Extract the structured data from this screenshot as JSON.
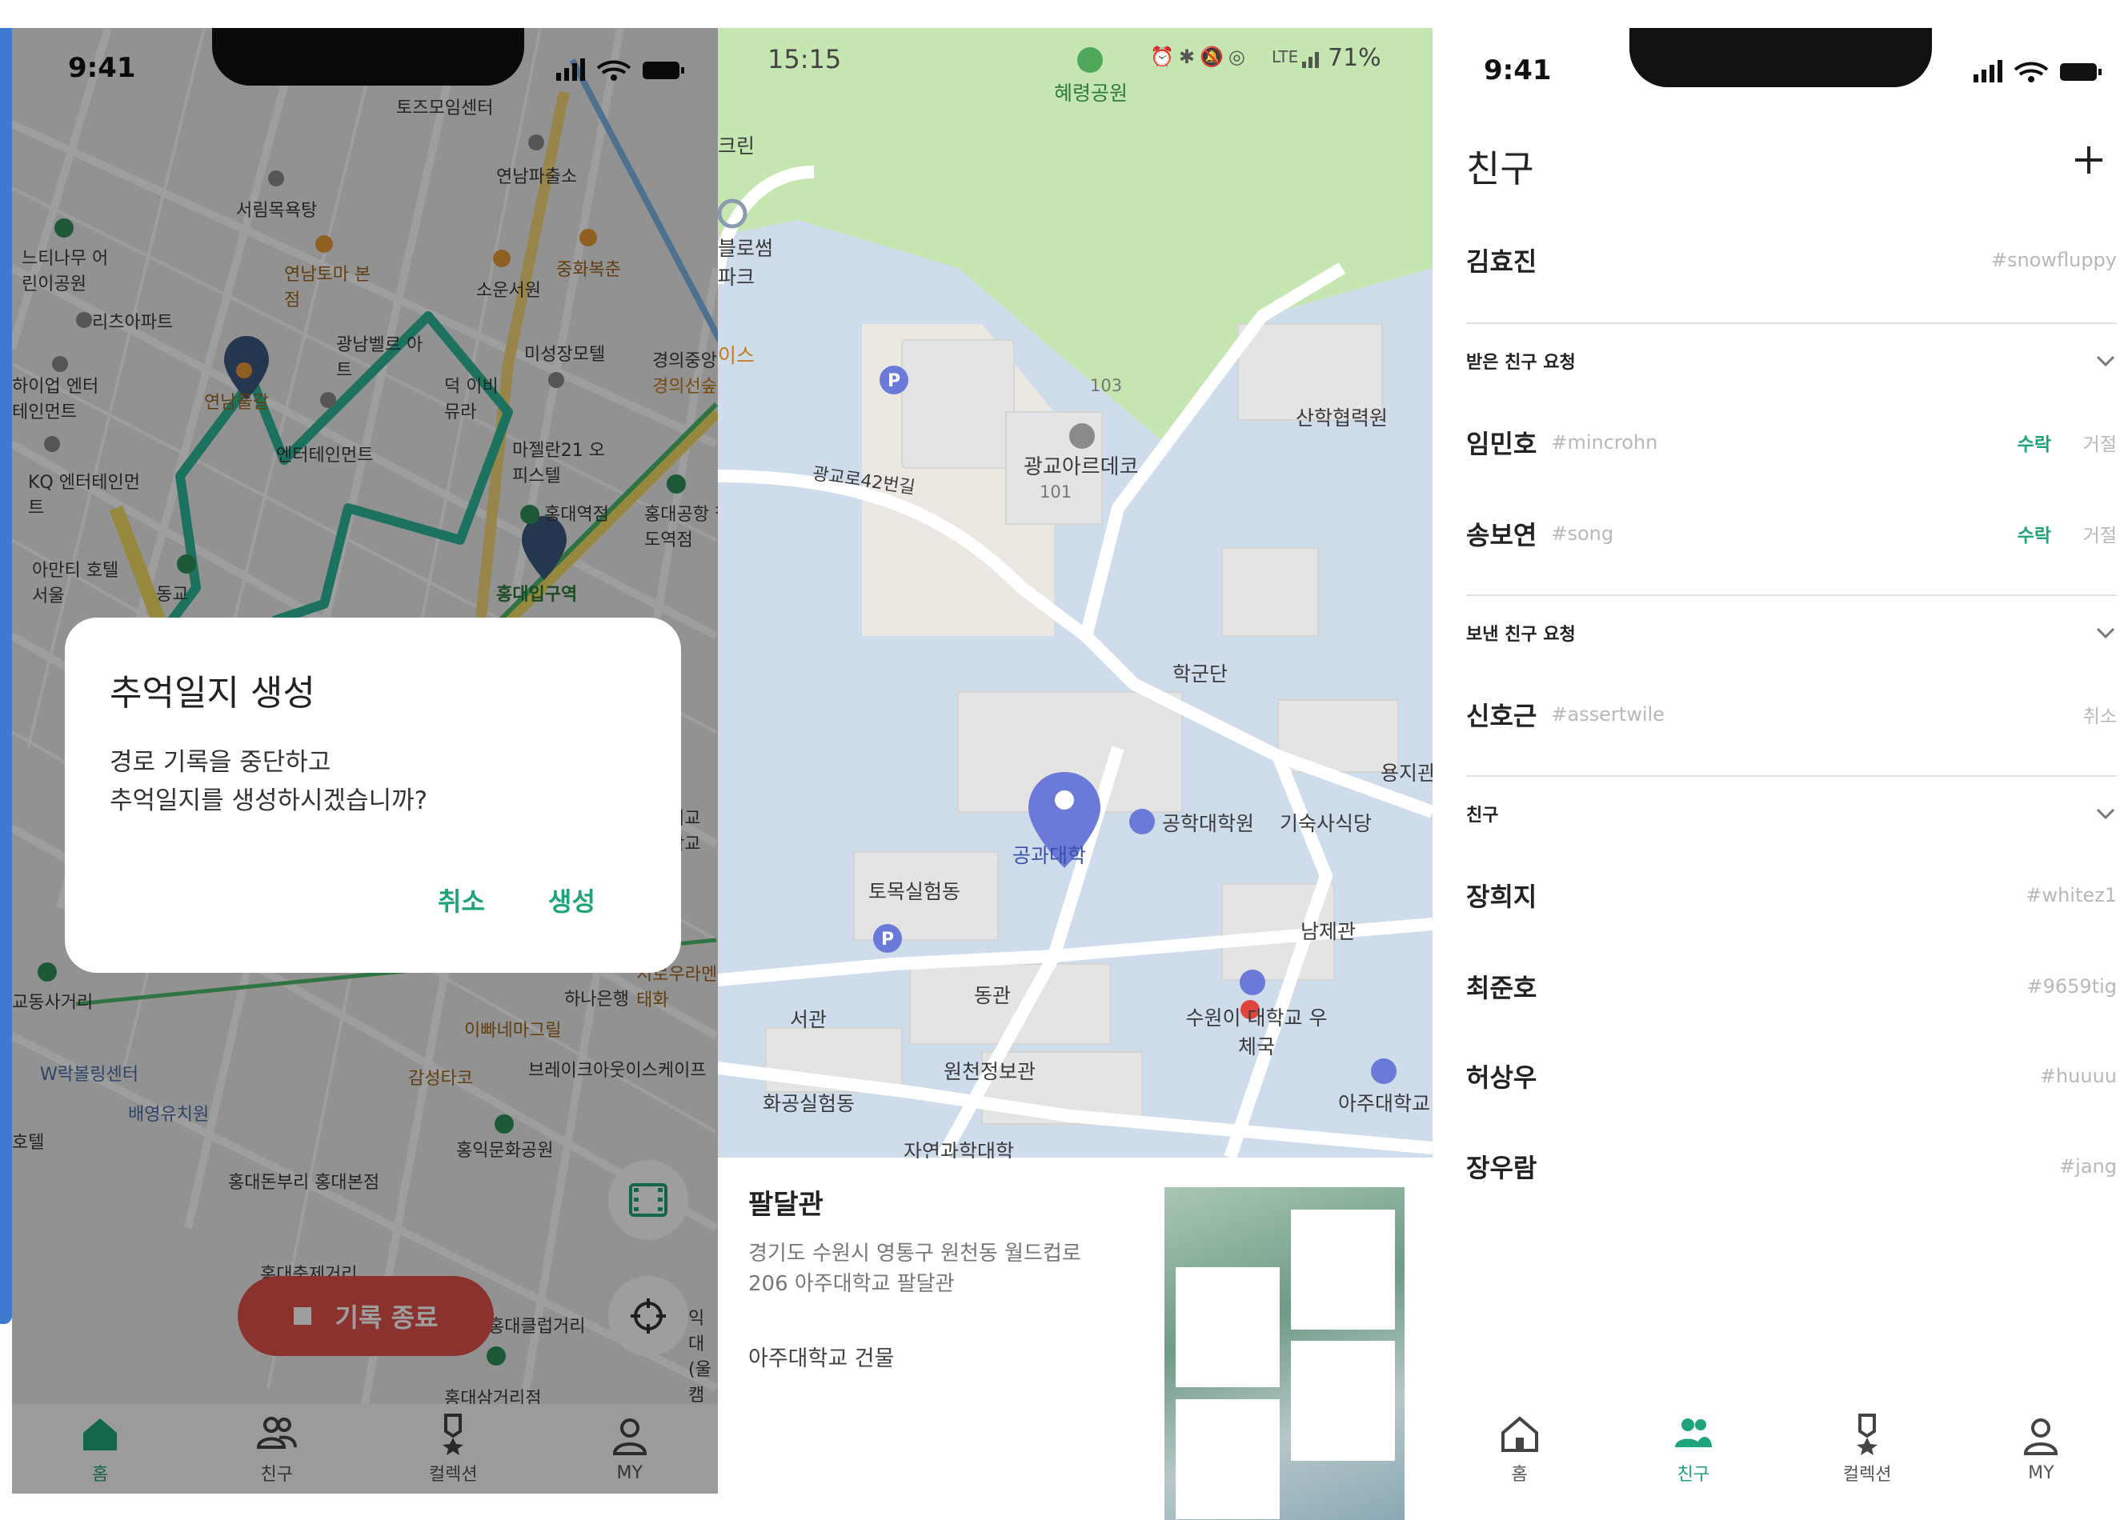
{
  "screen1": {
    "status_time": "9:41",
    "map_labels": [
      "토즈모임센터",
      "서림목욕탕",
      "연남파출소",
      "느티나무 어린이공원",
      "연남토마 본점",
      "중화복춘",
      "소운서원",
      "리츠아파트",
      "광남벨르 아트",
      "미성장모텔",
      "하이업 엔터테인먼트",
      "연남물갈",
      "덕 이비 뮤라",
      "경의중앙",
      "KQ 엔터테인먼트",
      "엔터테인먼트",
      "마젤란21 오피스텔",
      "홍대역점",
      "홍대공항 철도역점",
      "아만티 호텔서울",
      "동교",
      "홍대입구역",
      "서교 학교",
      "교동사거리",
      "하나은행",
      "지로우라멘 태화",
      "이빠네마그릴",
      "W락볼링센터",
      "감성타코",
      "브레이크아웃이스케이프",
      "배영유치원",
      "홍익문화공원",
      "홍대돈부리 홍대본점",
      "홍대축제거리",
      "홍대클럽거리",
      "홍대삼거리점",
      "익대 (울캠",
      "호텔",
      "경의선숲"
    ],
    "dialog": {
      "title": "추억일지 생성",
      "message_line1": "경로 기록을 중단하고",
      "message_line2": "추억일지를 생성하시겠습니까?",
      "cancel_label": "취소",
      "create_label": "생성"
    },
    "stop_record_label": "기록 종료",
    "tabs": [
      {
        "label": "홈",
        "icon": "home-icon",
        "active": true
      },
      {
        "label": "친구",
        "icon": "friends-icon",
        "active": false
      },
      {
        "label": "컬렉션",
        "icon": "medal-icon",
        "active": false
      },
      {
        "label": "MY",
        "icon": "person-icon",
        "active": false
      }
    ],
    "accent_color": "#1fa37a",
    "route_color": "#2fb89a",
    "stop_button_color": "#e0524b"
  },
  "screen2": {
    "status_time": "15:15",
    "status_battery": "71%",
    "status_network": "LTE",
    "map_labels": [
      "혜령공원",
      "크린",
      "블로썸 파크",
      "이스",
      "103",
      "광교아르데코",
      "101",
      "광교로42번길",
      "산학협력원",
      "학군단",
      "용지관",
      "공과대학",
      "공학대학원",
      "기숙사식당",
      "토목실험동",
      "남제관",
      "동관",
      "서관",
      "수원이 대학교 우체국",
      "원천정보관",
      "화공실험동",
      "아주대학교",
      "자연과학대학"
    ],
    "place": {
      "name": "팔달관",
      "address": "경기도 수원시 영통구 원천동 월드컵로 206 아주대학교 팔달관",
      "category": "아주대학교 건물"
    },
    "pin_color": "#6b79d8"
  },
  "screen3": {
    "status_time": "9:41",
    "title": "친구",
    "add_icon": "plus-icon",
    "me": {
      "name": "김효진",
      "tag": "#snowfluppy"
    },
    "received_section": "받은 친구 요청",
    "received": [
      {
        "name": "임민호",
        "tag": "#mincrohn",
        "accept": "수락",
        "reject": "거절"
      },
      {
        "name": "송보연",
        "tag": "#song",
        "accept": "수락",
        "reject": "거절"
      }
    ],
    "sent_section": "보낸 친구 요청",
    "sent": [
      {
        "name": "신호근",
        "tag": "#assertwile",
        "cancel": "취소"
      }
    ],
    "friends_section": "친구",
    "friends": [
      {
        "name": "장희지",
        "tag": "#whitez1"
      },
      {
        "name": "최준호",
        "tag": "#9659tig"
      },
      {
        "name": "허상우",
        "tag": "#huuuu"
      },
      {
        "name": "장우람",
        "tag": "#jang"
      }
    ],
    "tabs": [
      {
        "label": "홈",
        "icon": "home-icon",
        "active": false
      },
      {
        "label": "친구",
        "icon": "friends-icon",
        "active": true
      },
      {
        "label": "컬렉션",
        "icon": "medal-icon",
        "active": false
      },
      {
        "label": "MY",
        "icon": "person-icon",
        "active": false
      }
    ]
  }
}
